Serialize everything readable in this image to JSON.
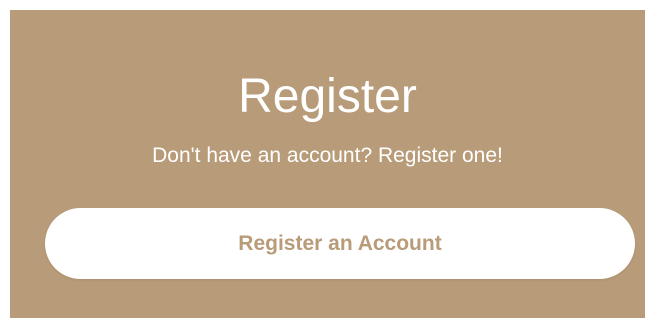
{
  "register": {
    "title": "Register",
    "subtitle": "Don't have an account? Register one!",
    "button_label": "Register an Account"
  },
  "colors": {
    "panel_bg": "#b89b78",
    "button_bg": "#ffffff",
    "button_text": "#b89b78",
    "text": "#ffffff"
  }
}
